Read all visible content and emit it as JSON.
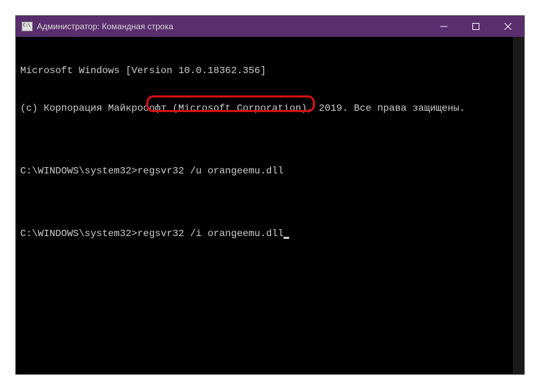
{
  "titlebar": {
    "title": "Администратор: Командная строка"
  },
  "console": {
    "line1": "Microsoft Windows [Version 10.0.18362.356]",
    "line2": "(c) Корпорация Майкрософт (Microsoft Corporation), 2019. Все права защищены.",
    "blank1": "",
    "prompt1_path": "C:\\WINDOWS\\system32>",
    "prompt1_cmd": "regsvr32 /u orangeemu.dll",
    "blank2": "",
    "prompt2_path": "C:\\WINDOWS\\system32>",
    "prompt2_cmd": "regsvr32 /i orangeemu.dll"
  }
}
